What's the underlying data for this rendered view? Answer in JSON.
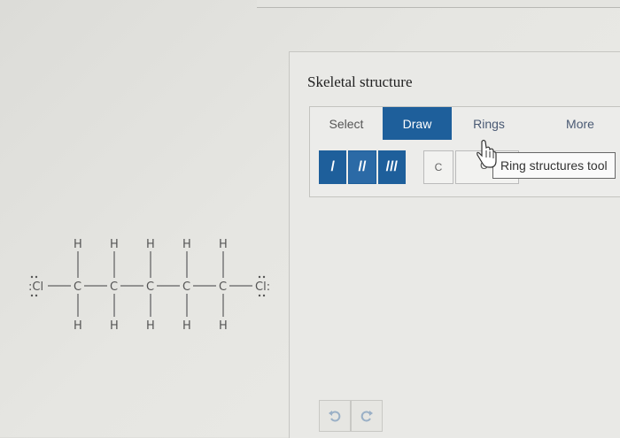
{
  "panel": {
    "title": "Skeletal structure"
  },
  "tabs": [
    {
      "label": "Select"
    },
    {
      "label": "Draw"
    },
    {
      "label": "Rings"
    },
    {
      "label": "More"
    }
  ],
  "tools": {
    "bonds": [
      {
        "glyph": "/",
        "name": "single-bond"
      },
      {
        "glyph": "//",
        "name": "double-bond"
      },
      {
        "glyph": "///",
        "name": "triple-bond"
      }
    ],
    "atom_label": "C",
    "tooltip": "Ring structures tool",
    "tooltip_fragment": "C"
  },
  "history": {
    "undo_icon": "undo-icon",
    "redo_icon": "redo-icon"
  },
  "molecule": {
    "left_atom": ":Cl",
    "right_atom": "Cl:",
    "carbon": "C",
    "hydrogen": "H"
  },
  "colors": {
    "accent": "#1e5f9b",
    "tab_text": "#4a5a74"
  }
}
